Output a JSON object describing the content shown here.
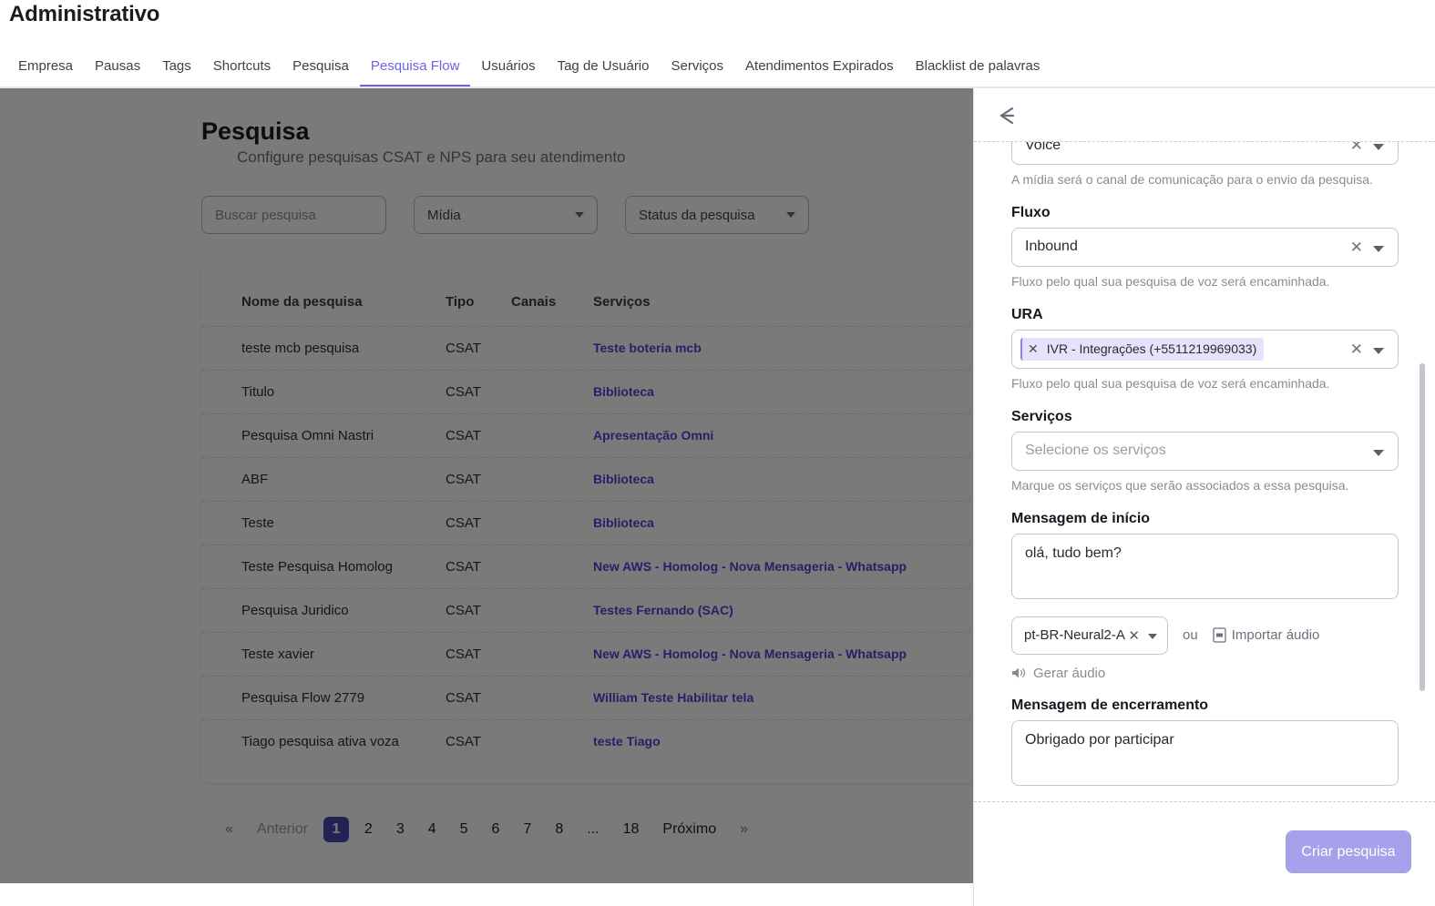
{
  "header": {
    "title": "Administrativo",
    "tabs": [
      {
        "label": "Empresa",
        "active": false
      },
      {
        "label": "Pausas",
        "active": false
      },
      {
        "label": "Tags",
        "active": false
      },
      {
        "label": "Shortcuts",
        "active": false
      },
      {
        "label": "Pesquisa",
        "active": false
      },
      {
        "label": "Pesquisa Flow",
        "active": true
      },
      {
        "label": "Usuários",
        "active": false
      },
      {
        "label": "Tag de Usuário",
        "active": false
      },
      {
        "label": "Serviços",
        "active": false
      },
      {
        "label": "Atendimentos Expirados",
        "active": false
      },
      {
        "label": "Blacklist de palavras",
        "active": false
      }
    ]
  },
  "main": {
    "title": "Pesquisa",
    "subtitle": "Configure pesquisas CSAT e NPS para seu atendimento",
    "filters": {
      "search_placeholder": "Buscar pesquisa",
      "search_value": "",
      "media_label": "Mídia",
      "status_label": "Status da pesquisa"
    },
    "table": {
      "columns": [
        "Nome da pesquisa",
        "Tipo",
        "Canais",
        "Serviços"
      ],
      "rows": [
        {
          "nome": "teste mcb pesquisa",
          "tipo": "CSAT",
          "canais": "",
          "servicos": "Teste boteria mcb"
        },
        {
          "nome": "Titulo",
          "tipo": "CSAT",
          "canais": "",
          "servicos": "Biblioteca"
        },
        {
          "nome": "Pesquisa Omni Nastri",
          "tipo": "CSAT",
          "canais": "",
          "servicos": "Apresentação Omni"
        },
        {
          "nome": "ABF",
          "tipo": "CSAT",
          "canais": "",
          "servicos": "Biblioteca"
        },
        {
          "nome": "Teste",
          "tipo": "CSAT",
          "canais": "",
          "servicos": "Biblioteca"
        },
        {
          "nome": "Teste Pesquisa Homolog",
          "tipo": "CSAT",
          "canais": "",
          "servicos": "New AWS - Homolog - Nova Mensageria - Whatsapp"
        },
        {
          "nome": "Pesquisa Juridico",
          "tipo": "CSAT",
          "canais": "",
          "servicos": "Testes Fernando (SAC)"
        },
        {
          "nome": "Teste xavier",
          "tipo": "CSAT",
          "canais": "",
          "servicos": "New AWS - Homolog - Nova Mensageria - Whatsapp"
        },
        {
          "nome": "Pesquisa Flow 2779",
          "tipo": "CSAT",
          "canais": "",
          "servicos": "William Teste Habilitar tela"
        },
        {
          "nome": "Tiago pesquisa ativa voza",
          "tipo": "CSAT",
          "canais": "",
          "servicos": "teste Tiago"
        }
      ]
    },
    "pagination": {
      "first_chevron": "«",
      "prev_label": "Anterior",
      "pages": [
        "1",
        "2",
        "3",
        "4",
        "5",
        "6",
        "7",
        "8",
        "...",
        "18"
      ],
      "current_page": "1",
      "next_label": "Próximo",
      "last_chevron": "»"
    }
  },
  "drawer": {
    "back_icon": "arrow-left-icon",
    "media_field": {
      "value": "Voice",
      "help": "A mídia será o canal de comunicação para o envio da pesquisa."
    },
    "fluxo_field": {
      "label": "Fluxo",
      "value": "Inbound",
      "help": "Fluxo pelo qual sua pesquisa de voz será encaminhada."
    },
    "ura_field": {
      "label": "URA",
      "chip": "IVR - Integrações (+5511219969033)",
      "help": "Fluxo pelo qual sua pesquisa de voz será encaminhada."
    },
    "servicos_field": {
      "label": "Serviços",
      "placeholder": "Selecione os serviços",
      "help": "Marque os serviços que serão associados a essa pesquisa."
    },
    "inicio_field": {
      "label": "Mensagem de início",
      "value": "olá, tudo bem?"
    },
    "audio_row": {
      "voice": "pt-BR-Neural2-A",
      "ou": "ou",
      "import_label": "Importar áudio",
      "generate_label": "Gerar áudio"
    },
    "encerramento_field": {
      "label": "Mensagem de encerramento",
      "value": "Obrigado por participar"
    },
    "footer": {
      "create_label": "Criar pesquisa"
    }
  },
  "colors": {
    "accent": "#6c63e8",
    "accent_dark": "#4b45b0",
    "link": "#4f46d6",
    "button_disabled": "#a6a1ea",
    "chip_bg": "#e5e2fb"
  }
}
